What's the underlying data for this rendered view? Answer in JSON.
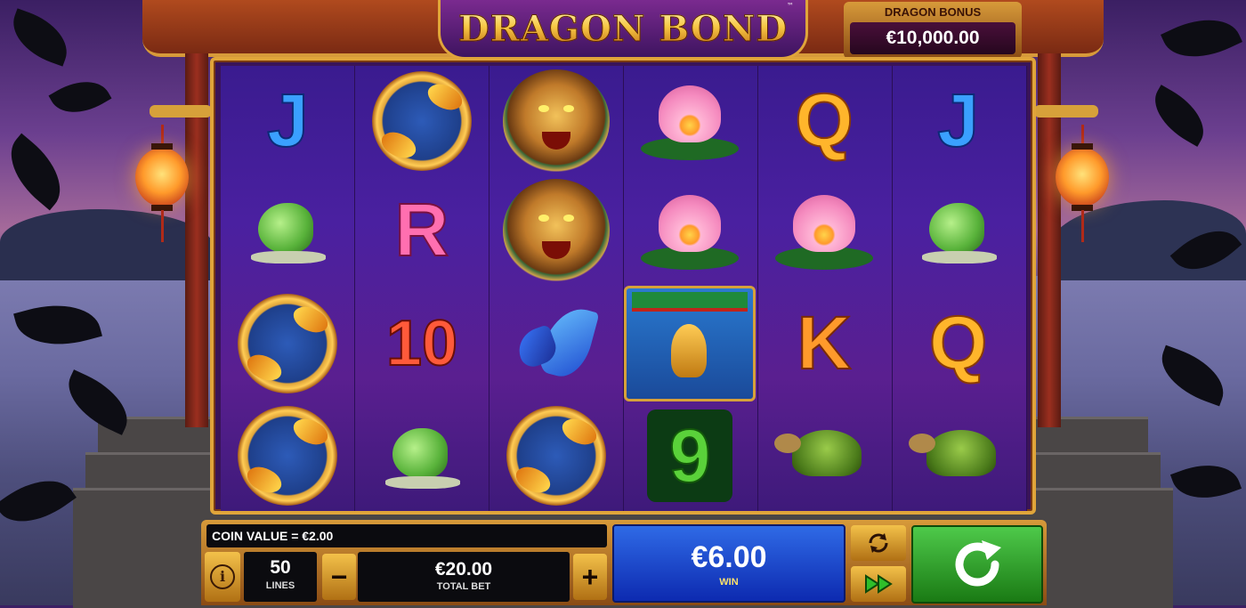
{
  "logo": {
    "text": "DRAGON BOND",
    "trademark": "™"
  },
  "bonus": {
    "label": "DRAGON BONUS",
    "value": "€10,000.00"
  },
  "reels": [
    [
      "letter-J",
      "frog",
      "koi",
      "koi"
    ],
    [
      "koi",
      "letter-R",
      "num-10",
      "frog"
    ],
    [
      "dragon",
      "dragon",
      "butterfly",
      "koi"
    ],
    [
      "lotus",
      "lotus",
      "gate",
      "num-9"
    ],
    [
      "letter-Q",
      "lotus",
      "letter-K",
      "turtle"
    ],
    [
      "letter-J",
      "frog",
      "letter-Q",
      "turtle"
    ]
  ],
  "symbol_text": {
    "letter-J": "J",
    "letter-R": "R",
    "letter-Q": "Q",
    "letter-K": "K",
    "num-10": "10",
    "num-9": "9"
  },
  "controls": {
    "coin_value": "COIN VALUE = €2.00",
    "lines_value": "50",
    "lines_label": "LINES",
    "total_bet_value": "€20.00",
    "total_bet_label": "TOTAL BET",
    "minus": "−",
    "plus": "+",
    "win_value": "€6.00",
    "win_label": "WIN",
    "info_icon": "i"
  },
  "colors": {
    "frame_gold": "#e0a53a",
    "win_blue": "#2f6ae6",
    "spin_green": "#4ec94a"
  }
}
